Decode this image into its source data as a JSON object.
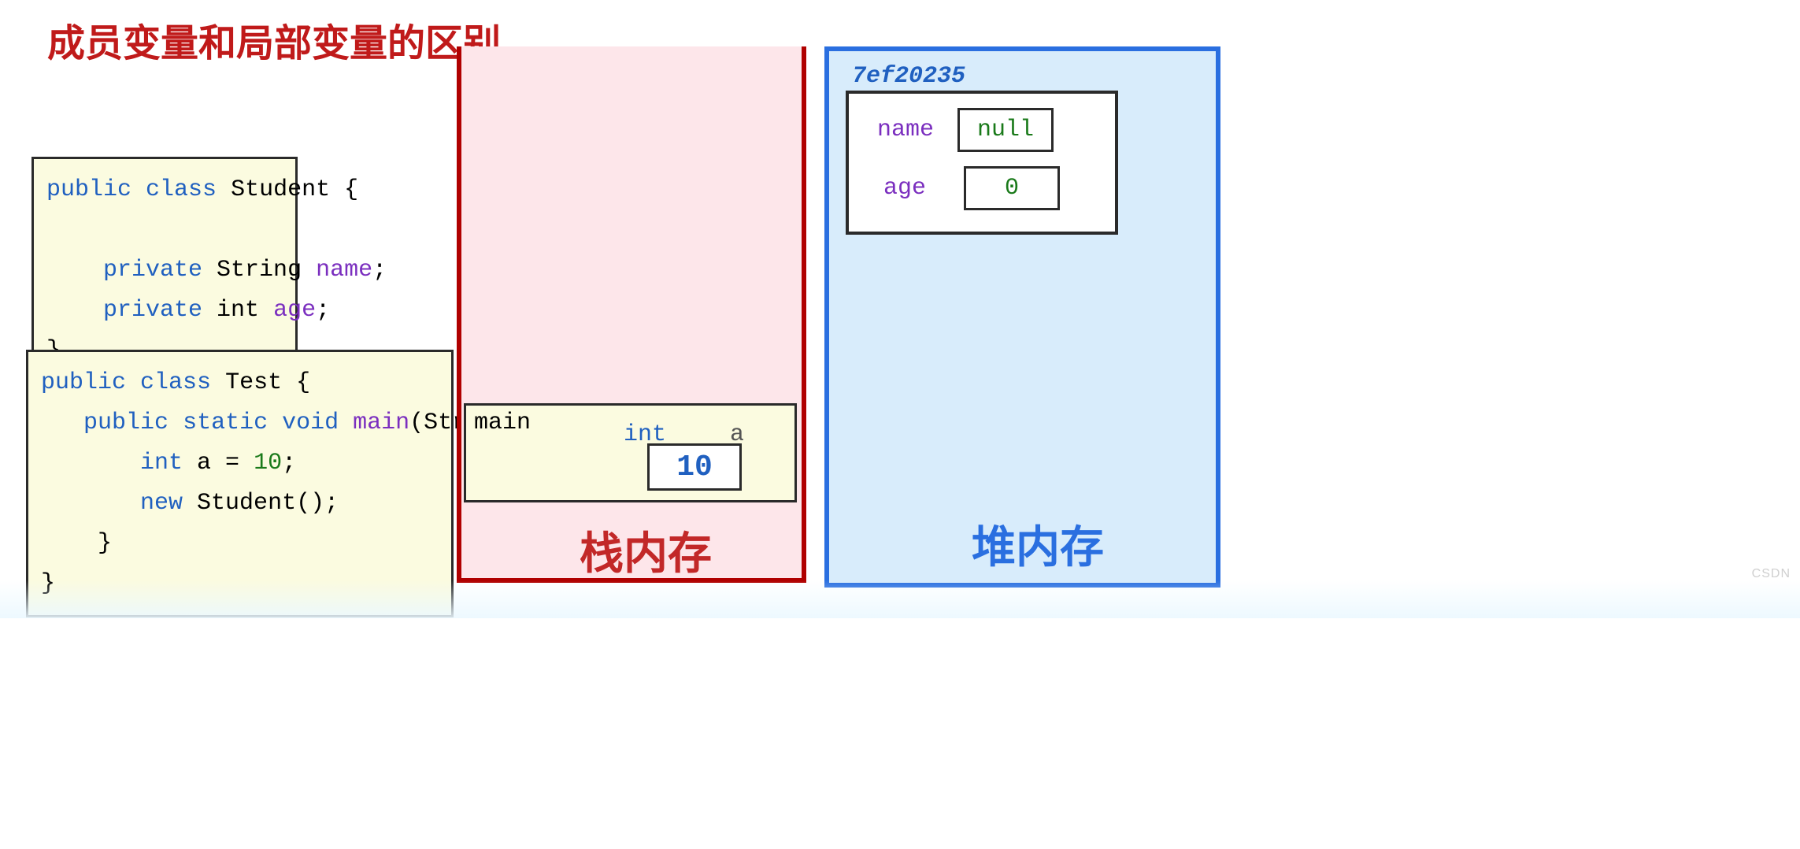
{
  "title": "成员变量和局部变量的区别",
  "code1": {
    "l1_kw1": "public",
    "l1_kw2": "class",
    "l1_rest": " Student {",
    "l2_kw": "private",
    "l2_type": " String ",
    "l2_name": "name",
    "l2_end": ";",
    "l3_kw": "private",
    "l3_type": " int ",
    "l3_name": "age",
    "l3_end": ";",
    "l4": "}"
  },
  "code2": {
    "l1_kw1": "public",
    "l1_kw2": "class",
    "l1_rest": " Test {",
    "l2_kw1": "public",
    "l2_kw2": "static",
    "l2_kw3": "void",
    "l2_name": " main",
    "l2_rest": "(String[] args){",
    "l3_kw": "int",
    "l3_mid": " a = ",
    "l3_num": "10",
    "l3_end": ";",
    "l4_kw": "new",
    "l4_rest": " Student();",
    "l5": "    }",
    "l6": "}"
  },
  "stack": {
    "label": "栈内存",
    "frame_name": "main",
    "var_type": "int",
    "var_name": "a",
    "var_value": "10"
  },
  "heap": {
    "label": "堆内存",
    "address": "7ef20235",
    "fields": {
      "name_label": "name",
      "name_value": "null",
      "age_label": "age",
      "age_value": "0"
    }
  },
  "watermark": "CSDN"
}
